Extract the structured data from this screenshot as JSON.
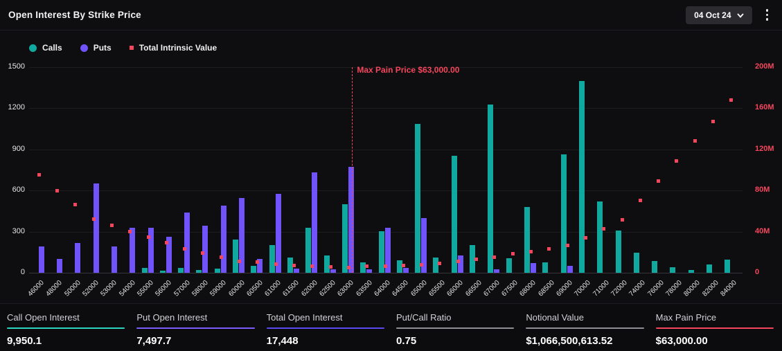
{
  "header": {
    "title": "Open Interest By Strike Price",
    "date_selector": "04 Oct 24"
  },
  "colors": {
    "calls": "#10a99f",
    "puts": "#7053fa",
    "tiv": "#f6465d",
    "stat_rule_call": "#2dd4bf",
    "stat_rule_put": "#7c5dff",
    "stat_rule_total": "#5b4af0",
    "stat_rule_gray": "#8f8f94",
    "stat_rule_maxpain": "#f6465d"
  },
  "chart_data": {
    "type": "bar",
    "title": "Open Interest By Strike Price",
    "grid": true,
    "legend_position": "top",
    "categories": [
      "46000",
      "48000",
      "50000",
      "52000",
      "53000",
      "54000",
      "55000",
      "56000",
      "57000",
      "58000",
      "59000",
      "60000",
      "60500",
      "61000",
      "61500",
      "62000",
      "62500",
      "63000",
      "63500",
      "64000",
      "64500",
      "65000",
      "65500",
      "66000",
      "66500",
      "67000",
      "67500",
      "68000",
      "68500",
      "69000",
      "70000",
      "71000",
      "72000",
      "74000",
      "76000",
      "78000",
      "80000",
      "82000",
      "84000"
    ],
    "series": [
      {
        "name": "Calls",
        "type": "bar",
        "axis": "left",
        "values": [
          0,
          0,
          0,
          0,
          0,
          0,
          35,
          15,
          35,
          20,
          30,
          240,
          50,
          200,
          110,
          330,
          125,
          500,
          75,
          305,
          90,
          1085,
          110,
          855,
          200,
          1225,
          105,
          480,
          75,
          865,
          1400,
          520,
          310,
          145,
          85,
          40,
          20,
          60,
          95
        ]
      },
      {
        "name": "Puts",
        "type": "bar",
        "axis": "left",
        "values": [
          190,
          100,
          215,
          650,
          190,
          330,
          330,
          265,
          440,
          345,
          490,
          545,
          100,
          575,
          30,
          730,
          25,
          775,
          25,
          330,
          35,
          400,
          0,
          125,
          0,
          25,
          0,
          70,
          0,
          50,
          0,
          0,
          0,
          0,
          0,
          0,
          0,
          0,
          0
        ]
      },
      {
        "name": "Total Intrinsic Value",
        "type": "scatter",
        "axis": "right",
        "values": [
          95,
          80,
          66,
          52,
          46,
          40,
          34.5,
          29.5,
          23.5,
          19.5,
          15,
          11.3,
          10.2,
          8.2,
          7.3,
          6.4,
          5.8,
          5.3,
          6.2,
          6.6,
          7.2,
          7.7,
          9.2,
          10.9,
          13.2,
          15.2,
          18.2,
          20.5,
          23.5,
          26.7,
          33.8,
          42.7,
          51.3,
          70.7,
          89.5,
          109,
          128,
          147,
          168
        ]
      }
    ],
    "left_axis": {
      "label": "",
      "ticks": [
        "0",
        "300",
        "600",
        "900",
        "1200",
        "1500"
      ],
      "min": 0,
      "max": 1500
    },
    "right_axis": {
      "label": "",
      "ticks": [
        "0",
        "40M",
        "80M",
        "120M",
        "160M",
        "200M"
      ],
      "min": 0,
      "max": 200,
      "unit": "M"
    },
    "annotation": {
      "label": "Max Pain Price $63,000.00",
      "category": "63000"
    }
  },
  "stats": [
    {
      "label": "Call Open Interest",
      "value": "9,950.1"
    },
    {
      "label": "Put Open Interest",
      "value": "7,497.7"
    },
    {
      "label": "Total Open Interest",
      "value": "17,448"
    },
    {
      "label": "Put/Call Ratio",
      "value": "0.75"
    },
    {
      "label": "Notional Value",
      "value": "$1,066,500,613.52"
    },
    {
      "label": "Max Pain Price",
      "value": "$63,000.00"
    }
  ]
}
